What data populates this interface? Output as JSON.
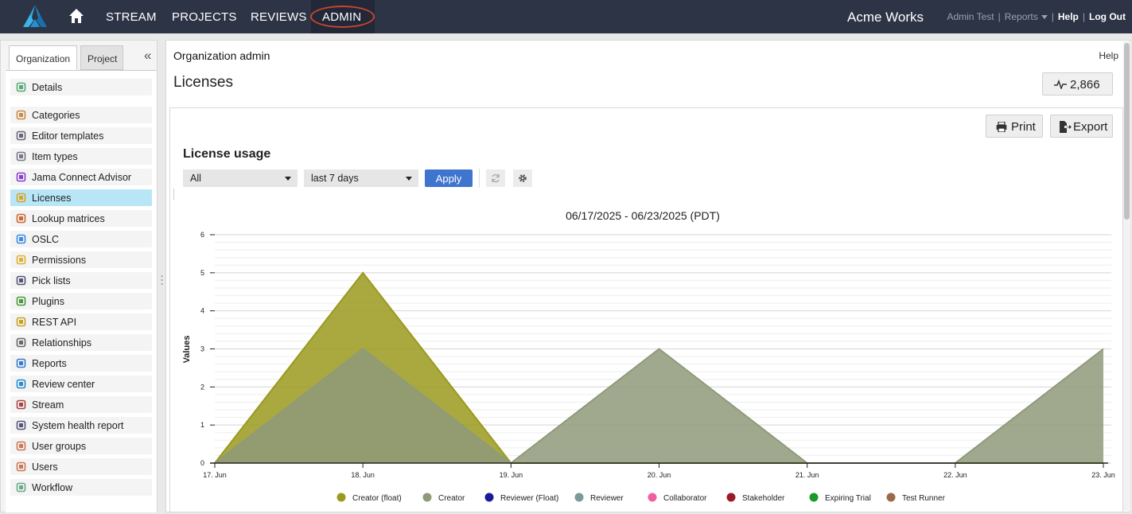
{
  "topbar": {
    "nav": [
      "STREAM",
      "PROJECTS",
      "REVIEWS",
      "ADMIN"
    ],
    "org_name": "Acme Works",
    "user": "Admin Test",
    "reports": "Reports",
    "help": "Help",
    "logout": "Log Out",
    "sep": "|"
  },
  "sidebar": {
    "tabs": [
      "Organization",
      "Project"
    ],
    "collapse": "«",
    "items": [
      {
        "label": "Details",
        "icon": "details-icon"
      },
      {
        "label": "Categories",
        "icon": "tag-icon"
      },
      {
        "label": "Editor templates",
        "icon": "template-icon"
      },
      {
        "label": "Item types",
        "icon": "item-types-icon"
      },
      {
        "label": "Jama Connect Advisor",
        "icon": "advisor-icon"
      },
      {
        "label": "Licenses",
        "icon": "key-icon",
        "selected": true
      },
      {
        "label": "Lookup matrices",
        "icon": "matrix-icon"
      },
      {
        "label": "OSLC",
        "icon": "oslc-icon"
      },
      {
        "label": "Permissions",
        "icon": "shield-icon"
      },
      {
        "label": "Pick lists",
        "icon": "list-icon"
      },
      {
        "label": "Plugins",
        "icon": "puzzle-icon"
      },
      {
        "label": "REST API",
        "icon": "api-key-icon"
      },
      {
        "label": "Relationships",
        "icon": "link-icon"
      },
      {
        "label": "Reports",
        "icon": "chart-icon"
      },
      {
        "label": "Review center",
        "icon": "review-icon"
      },
      {
        "label": "Stream",
        "icon": "stream-icon"
      },
      {
        "label": "System health report",
        "icon": "health-icon"
      },
      {
        "label": "User groups",
        "icon": "user-group-icon"
      },
      {
        "label": "Users",
        "icon": "user-icon"
      },
      {
        "label": "Workflow",
        "icon": "workflow-icon"
      }
    ]
  },
  "main": {
    "breadcrumb": "Organization admin",
    "help": "Help",
    "title": "Licenses",
    "activity_count": "2,866",
    "print": "Print",
    "export": "Export",
    "section_title": "License usage",
    "filter_license": "All",
    "filter_range": "last 7 days",
    "apply": "Apply"
  },
  "colors": {
    "topbar": "#2d3446",
    "accent": "#3f74cf",
    "selected": "#b9e6f7",
    "creator_float": "#9a9a1e",
    "creator": "#8f9a7a"
  },
  "chart_data": {
    "type": "area",
    "title": "06/17/2025 - 06/23/2025 (PDT)",
    "ylabel": "Values",
    "xlabel": "",
    "x": [
      "17. Jun",
      "18. Jun",
      "19. Jun",
      "20. Jun",
      "21. Jun",
      "22. Jun",
      "23. Jun"
    ],
    "ylim": [
      0,
      6
    ],
    "yticks": [
      0,
      1,
      2,
      3,
      4,
      5,
      6
    ],
    "grid": true,
    "legend_position": "bottom",
    "series": [
      {
        "name": "Creator (float)",
        "color": "#9a9a1e",
        "values": [
          0,
          5,
          0,
          0,
          0,
          0,
          0
        ]
      },
      {
        "name": "Creator",
        "color": "#8f9a7a",
        "values": [
          0,
          3,
          0,
          3,
          0,
          0,
          3
        ]
      },
      {
        "name": "Reviewer (Float)",
        "color": "#1a1a9a",
        "values": [
          0,
          0,
          0,
          0,
          0,
          0,
          0
        ]
      },
      {
        "name": "Reviewer",
        "color": "#7a9a9a",
        "values": [
          0,
          0,
          0,
          0,
          0,
          0,
          0
        ]
      },
      {
        "name": "Collaborator",
        "color": "#f060a0",
        "values": [
          0,
          0,
          0,
          0,
          0,
          0,
          0
        ]
      },
      {
        "name": "Stakeholder",
        "color": "#9a1a2a",
        "values": [
          0,
          0,
          0,
          0,
          0,
          0,
          0
        ]
      },
      {
        "name": "Expiring Trial",
        "color": "#1a9a2a",
        "values": [
          0,
          0,
          0,
          0,
          0,
          0,
          0
        ]
      },
      {
        "name": "Test Runner",
        "color": "#9a6a4a",
        "values": [
          0,
          0,
          0,
          0,
          0,
          0,
          0
        ]
      }
    ]
  }
}
